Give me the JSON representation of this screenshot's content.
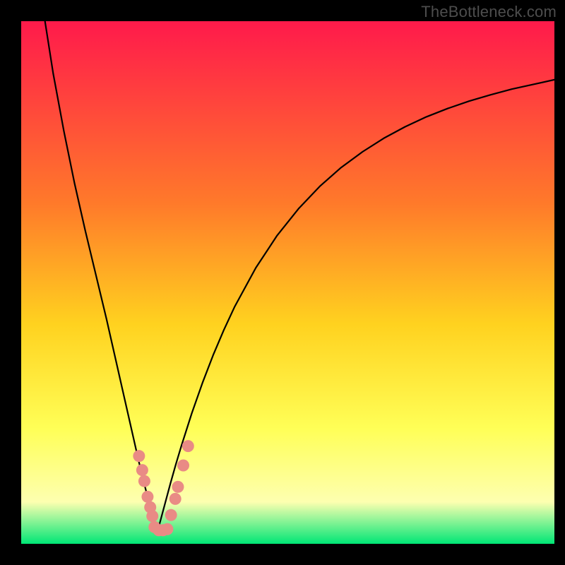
{
  "watermark": "TheBottleneck.com",
  "colors": {
    "gradient_top": "#ff1a4b",
    "gradient_mid1": "#ff7a2a",
    "gradient_mid2": "#ffd21f",
    "gradient_mid3": "#ffff57",
    "gradient_mid4": "#fdffb0",
    "gradient_bottom": "#00e676",
    "curve": "#000000",
    "dot": "#e98b85",
    "frame": "#000000"
  },
  "chart_data": {
    "type": "line",
    "title": "",
    "xlabel": "",
    "ylabel": "",
    "xlim": [
      0,
      100
    ],
    "ylim": [
      0,
      100
    ],
    "x_minimum": 25.5,
    "series": [
      {
        "name": "bottleneck-curve",
        "x": [
          0,
          2,
          4,
          6,
          8,
          10,
          12,
          14,
          16,
          17,
          18,
          19,
          20,
          21,
          22,
          23,
          24,
          24.5,
          25,
          25.5,
          26,
          26.5,
          27,
          28,
          29,
          30,
          32,
          34,
          36,
          38,
          40,
          44,
          48,
          52,
          56,
          60,
          64,
          68,
          72,
          76,
          80,
          84,
          88,
          92,
          96,
          100
        ],
        "y": [
          145,
          120,
          103,
          90,
          79,
          69,
          60,
          51.5,
          43,
          38.5,
          34,
          29.5,
          25,
          20.5,
          16,
          11.8,
          7.8,
          5.9,
          4.1,
          2.6,
          4.0,
          5.9,
          7.8,
          11.6,
          15.2,
          18.6,
          25.0,
          30.8,
          36.1,
          40.9,
          45.3,
          52.8,
          59.0,
          64.1,
          68.4,
          72.0,
          75.0,
          77.6,
          79.8,
          81.7,
          83.3,
          84.7,
          85.9,
          87.0,
          87.9,
          88.8
        ]
      }
    ],
    "dots": [
      {
        "x": 22.1,
        "y": 16.8
      },
      {
        "x": 22.7,
        "y": 14.1
      },
      {
        "x": 23.1,
        "y": 12.0
      },
      {
        "x": 23.7,
        "y": 9.0
      },
      {
        "x": 24.2,
        "y": 7.0
      },
      {
        "x": 24.6,
        "y": 5.3
      },
      {
        "x": 25.0,
        "y": 3.2
      },
      {
        "x": 25.8,
        "y": 2.6
      },
      {
        "x": 26.6,
        "y": 2.6
      },
      {
        "x": 27.4,
        "y": 2.8
      },
      {
        "x": 28.1,
        "y": 5.5
      },
      {
        "x": 28.9,
        "y": 8.6
      },
      {
        "x": 29.4,
        "y": 10.9
      },
      {
        "x": 30.4,
        "y": 15.0
      },
      {
        "x": 31.3,
        "y": 18.7
      }
    ]
  }
}
